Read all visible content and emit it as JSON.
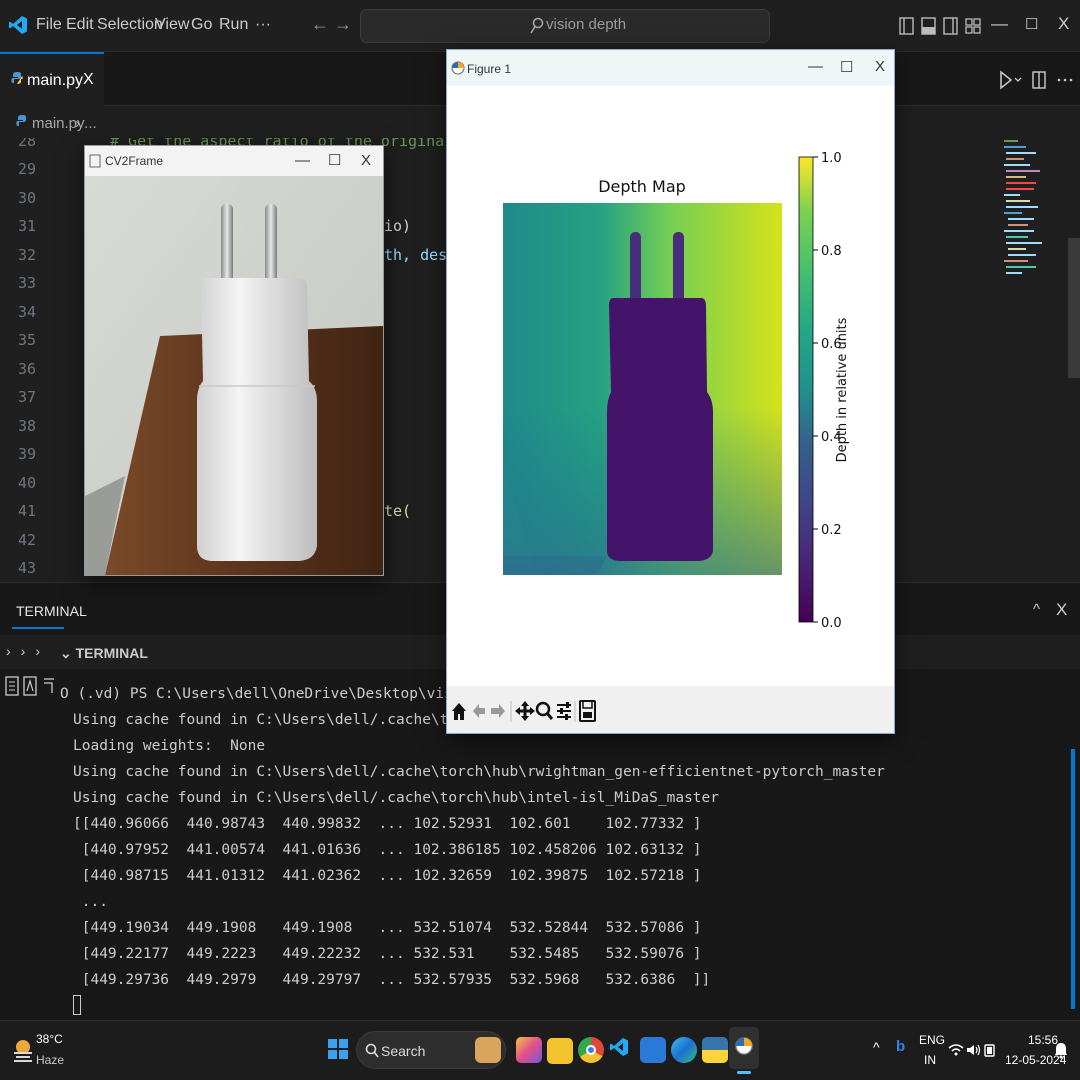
{
  "colors": {
    "accent": "#0078d4",
    "vscode_blue": "#23a9f2",
    "prompt_yellow": "#e5e510"
  },
  "titlebar": {
    "menu": [
      "File",
      "Edit",
      "Selection",
      "View",
      "Go",
      "Run",
      "···"
    ],
    "search_text": "vision depth",
    "icons": [
      "vscode-logo-icon",
      "back-arrow-icon",
      "forward-arrow-icon",
      "search-icon",
      "layout-icons"
    ]
  },
  "tabs": [
    {
      "label": "main.py",
      "close": "X"
    }
  ],
  "breadcrumb": {
    "file": "main.py",
    "rest": "› ..."
  },
  "editor": {
    "line_numbers": [
      "28",
      "29",
      "30",
      "31",
      "32",
      "33",
      "34",
      "35",
      "36",
      "37",
      "38",
      "39",
      "40",
      "41",
      "42",
      "43"
    ],
    "comment_partial": "# Get the aspect ratio of the original frame",
    "frag_31": "io)",
    "frag_32": "th, desire",
    "frag_41": "te("
  },
  "panel": {
    "tab": "TERMINAL",
    "subheader": "TERMINAL",
    "terminal_lines": [
      "O (.vd) PS C:\\Users\\dell\\OneDrive\\Desktop\\vision depth> py mai",
      "Using cache found in C:\\Users\\dell/.cache\\torch\\hub\\intel-isl",
      "Loading weights:  None",
      "Using cache found in C:\\Users\\dell/.cache\\torch\\hub\\rwightman_gen-efficientnet-pytorch_master",
      "Using cache found in C:\\Users\\dell/.cache\\torch\\hub\\intel-isl_MiDaS_master",
      "[[440.96066  440.98743  440.99832  ... 102.52931  102.601    102.77332 ]",
      " [440.97952  441.00574  441.01636  ... 102.386185 102.458206 102.63132 ]",
      " [440.98715  441.01312  441.02362  ... 102.32659  102.39875  102.57218 ]",
      " ...",
      " [449.19034  449.1908   449.1908   ... 532.51074  532.52844  532.57086 ]",
      " [449.22177  449.2223   449.22232  ... 532.531    532.5485   532.59076 ]",
      " [449.29736  449.2979   449.29797  ... 532.57935  532.5968   532.6386  ]]"
    ]
  },
  "cv2_window": {
    "title": "CV2Frame",
    "controls": [
      "—",
      "☐",
      "X"
    ]
  },
  "figure_window": {
    "title": "Figure 1",
    "controls": [
      "—",
      "☐",
      "X"
    ],
    "toolbar": [
      "home-icon",
      "back-icon",
      "forward-icon",
      "pan-icon",
      "zoom-icon",
      "configure-icon",
      "save-icon"
    ]
  },
  "chart_data": {
    "type": "heatmap",
    "title": "Depth Map",
    "colormap": "viridis",
    "colorbar_label": "Depth in relative units",
    "colorbar_range": [
      0.0,
      1.0
    ],
    "colorbar_ticks": [
      "0.0",
      "0.2",
      "0.4",
      "0.6",
      "0.8",
      "1.0"
    ]
  },
  "taskbar": {
    "weather_temp": "38°C",
    "weather_desc": "Haze",
    "search": "Search",
    "lang": "ENG",
    "region": "IN",
    "time": "15:56",
    "date": "12-05-2024"
  }
}
